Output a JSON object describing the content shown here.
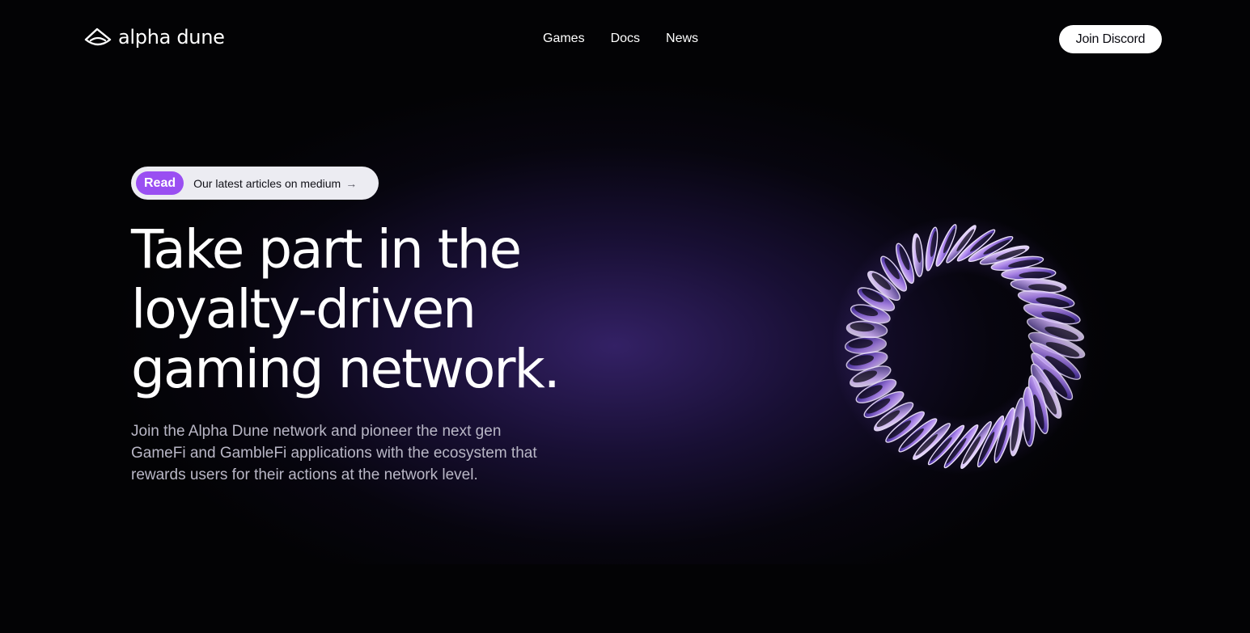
{
  "brand": {
    "name": "alpha dune",
    "icon": "dune-eye-logo-icon"
  },
  "nav": {
    "links": [
      {
        "label": "Games"
      },
      {
        "label": "Docs"
      },
      {
        "label": "News"
      }
    ],
    "cta_label": "Join Discord"
  },
  "hero": {
    "pill": {
      "badge": "Read",
      "text": "Our latest articles on medium",
      "arrow_icon": "arrow-right-icon",
      "badge_color": "#9a4ff2"
    },
    "headline_lines": [
      "Take part in the",
      "loyalty-driven",
      "gaming network."
    ],
    "description": "Join the Alpha Dune network and pioneer the next gen GameFi and GambleFi applications with the ecosystem that rewards users for their actions at the network level.",
    "graphic": "twisted-ring-illustration"
  },
  "colors": {
    "background": "#030305",
    "accent": "#9a4ff2",
    "glow": "#3c2676"
  }
}
